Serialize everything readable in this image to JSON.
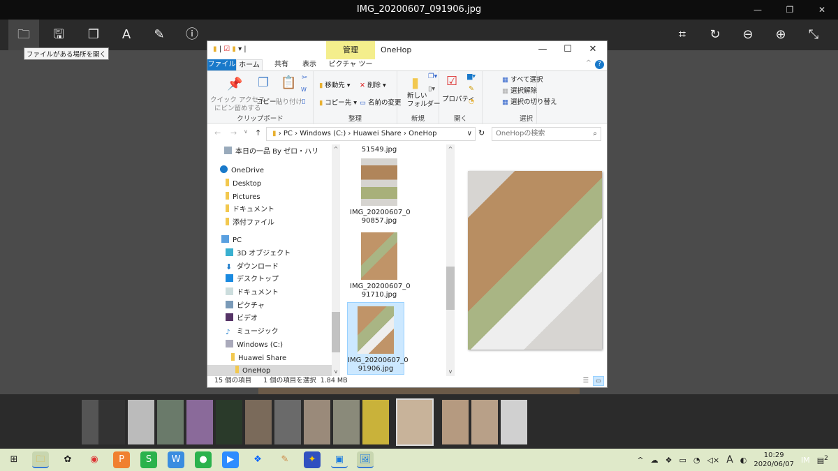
{
  "viewer": {
    "title": "IMG_20200607_091906.jpg",
    "tooltip": "ファイルがある場所を開く",
    "toolbar_left": [
      "folder-icon",
      "save-icon",
      "copy-icon",
      "text-recognition-icon",
      "edit-icon",
      "info-icon"
    ],
    "toolbar_right": [
      "crop-icon",
      "rotate-icon",
      "zoom-out-icon",
      "zoom-in-icon",
      "fullscreen-icon"
    ]
  },
  "explorer": {
    "title": "OneHop",
    "context_tab": "管理",
    "tabs": [
      "ファイル",
      "ホーム",
      "共有",
      "表示",
      "ピクチャ ツール"
    ],
    "ribbon": {
      "clipboard": {
        "label": "クリップボード",
        "pin": "クイック アクセス\nにピン留めする",
        "copy": "コピー",
        "paste": "貼り付け"
      },
      "organize": {
        "label": "整理",
        "move": "移動先",
        "delete": "削除",
        "copyto": "コピー先",
        "rename": "名前の変更"
      },
      "new": {
        "label": "新規",
        "folder": "新しい\nフォルダー"
      },
      "open": {
        "label": "開く",
        "properties": "プロパティ"
      },
      "select": {
        "label": "選択",
        "all": "すべて選択",
        "none": "選択解除",
        "invert": "選択の切り替え"
      }
    },
    "address": [
      "PC",
      "Windows (C:)",
      "Huawei Share",
      "OneHop"
    ],
    "search_placeholder": "OneHopの検索",
    "nav": [
      {
        "label": "本日の一品 By ゼロ・ハリ",
        "level": 1
      },
      {
        "label": "OneDrive",
        "level": 0
      },
      {
        "label": "Desktop",
        "level": 1
      },
      {
        "label": "Pictures",
        "level": 1
      },
      {
        "label": "ドキュメント",
        "level": 1
      },
      {
        "label": "添付ファイル",
        "level": 1
      },
      {
        "label": "PC",
        "level": 0
      },
      {
        "label": "3D オブジェクト",
        "level": 1
      },
      {
        "label": "ダウンロード",
        "level": 1
      },
      {
        "label": "デスクトップ",
        "level": 1
      },
      {
        "label": "ドキュメント",
        "level": 1
      },
      {
        "label": "ピクチャ",
        "level": 1
      },
      {
        "label": "ビデオ",
        "level": 1
      },
      {
        "label": "ミュージック",
        "level": 1
      },
      {
        "label": "Windows (C:)",
        "level": 1
      },
      {
        "label": "Huawei Share",
        "level": 2
      },
      {
        "label": "OneHop",
        "level": 3
      }
    ],
    "files": [
      "51549.jpg",
      "IMG_20200607_0\n90857.jpg",
      "IMG_20200607_0\n91710.jpg",
      "IMG_20200607_0\n91906.jpg"
    ],
    "status": {
      "count": "15 個の項目",
      "selected": "1 個の項目を選択  1.84 MB"
    }
  },
  "taskbar": {
    "time": "10:29",
    "date": "2020/06/07",
    "notifications": "2",
    "ime": "A"
  }
}
